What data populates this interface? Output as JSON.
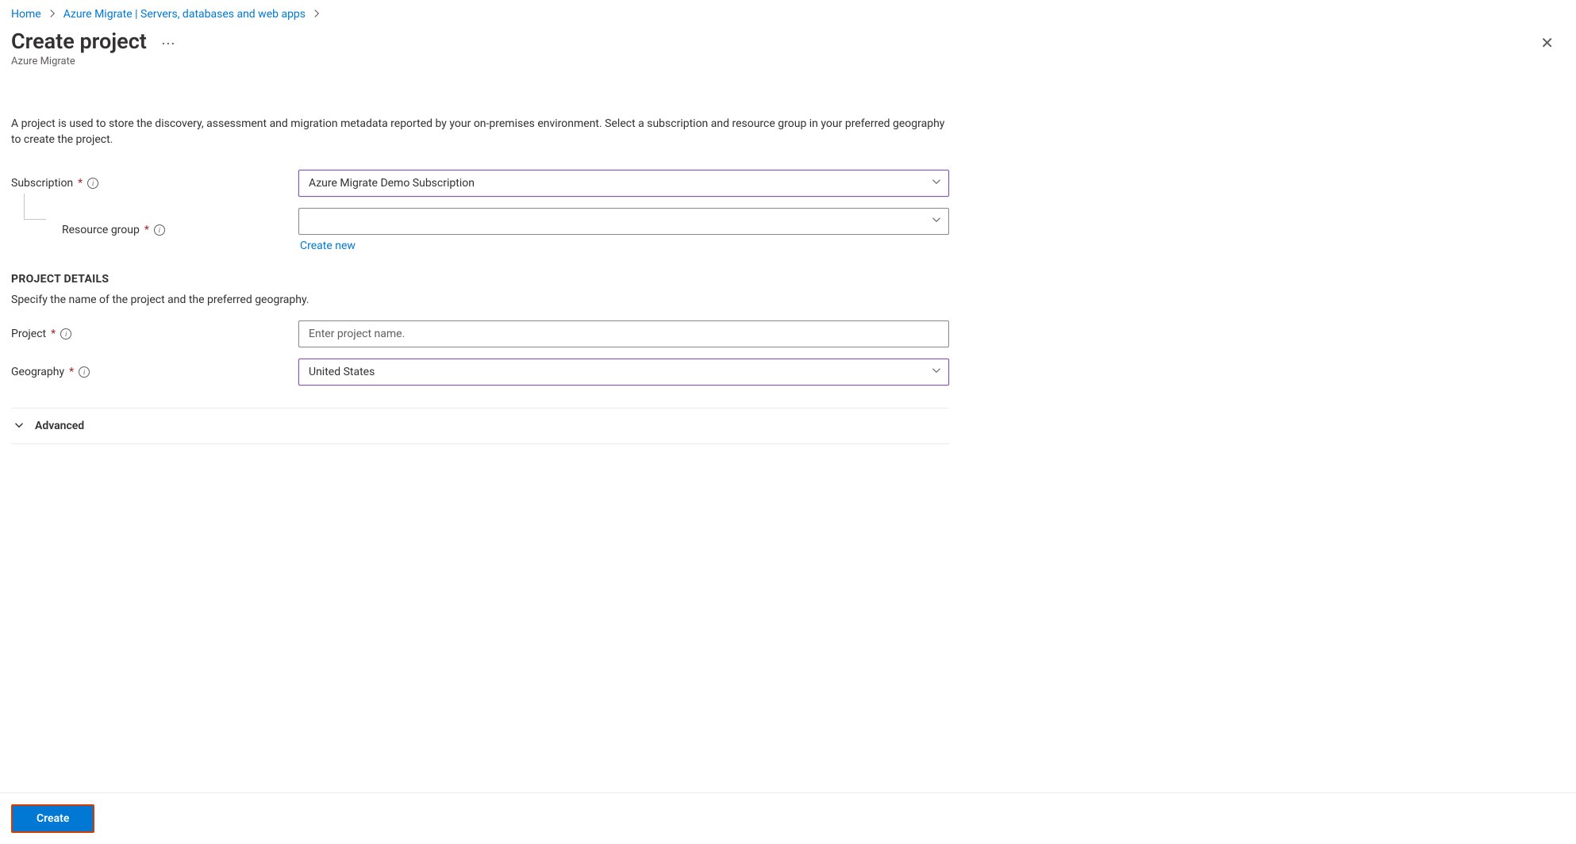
{
  "breadcrumb": {
    "items": [
      {
        "label": "Home"
      },
      {
        "label": "Azure Migrate | Servers, databases and web apps"
      }
    ]
  },
  "header": {
    "title": "Create project",
    "subtitle": "Azure Migrate"
  },
  "description": "A project is used to store the discovery, assessment and migration metadata reported by your on-premises environment. Select a subscription and resource group in your preferred geography to create the project.",
  "form": {
    "subscription": {
      "label": "Subscription",
      "value": "Azure Migrate Demo Subscription"
    },
    "resource_group": {
      "label": "Resource group",
      "value": "",
      "create_new": "Create new"
    },
    "project_details_heading": "PROJECT DETAILS",
    "project_details_desc": "Specify the name of the project and the preferred geography.",
    "project": {
      "label": "Project",
      "placeholder": "Enter project name."
    },
    "geography": {
      "label": "Geography",
      "value": "United States"
    },
    "advanced_label": "Advanced"
  },
  "footer": {
    "create_button": "Create"
  }
}
